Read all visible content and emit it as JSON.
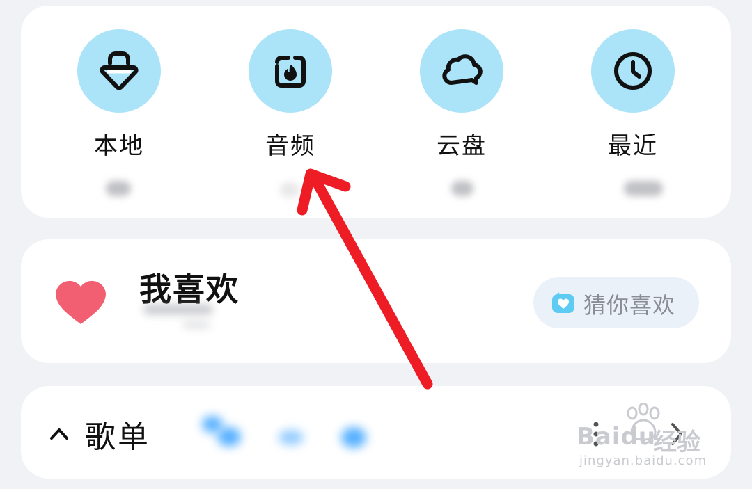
{
  "quick_access": [
    {
      "label": "本地",
      "icon": "lock-bag-icon"
    },
    {
      "label": "音频",
      "icon": "flame-box-icon"
    },
    {
      "label": "云盘",
      "icon": "cloud-icon"
    },
    {
      "label": "最近",
      "icon": "clock-icon"
    }
  ],
  "favorites": {
    "title": "我喜欢",
    "icon": "heart-icon",
    "guess_button": {
      "label": "猜你喜欢",
      "icon": "heart-box-icon"
    }
  },
  "playlist": {
    "title": "歌单",
    "expand_icon": "chevron-up-icon",
    "more_icon": "more-vertical-icon",
    "open_icon": "chevron-right-icon"
  },
  "watermark": {
    "brand": "Baidu",
    "brand_cn": "经验",
    "url": "jingyan.baidu.com"
  },
  "colors": {
    "background": "#f1f2f6",
    "card": "#ffffff",
    "icon_circle": "#abe3f8",
    "heart": "#f25f72",
    "arrow": "#ee1c25",
    "accent_blue": "#3ba3ff"
  }
}
